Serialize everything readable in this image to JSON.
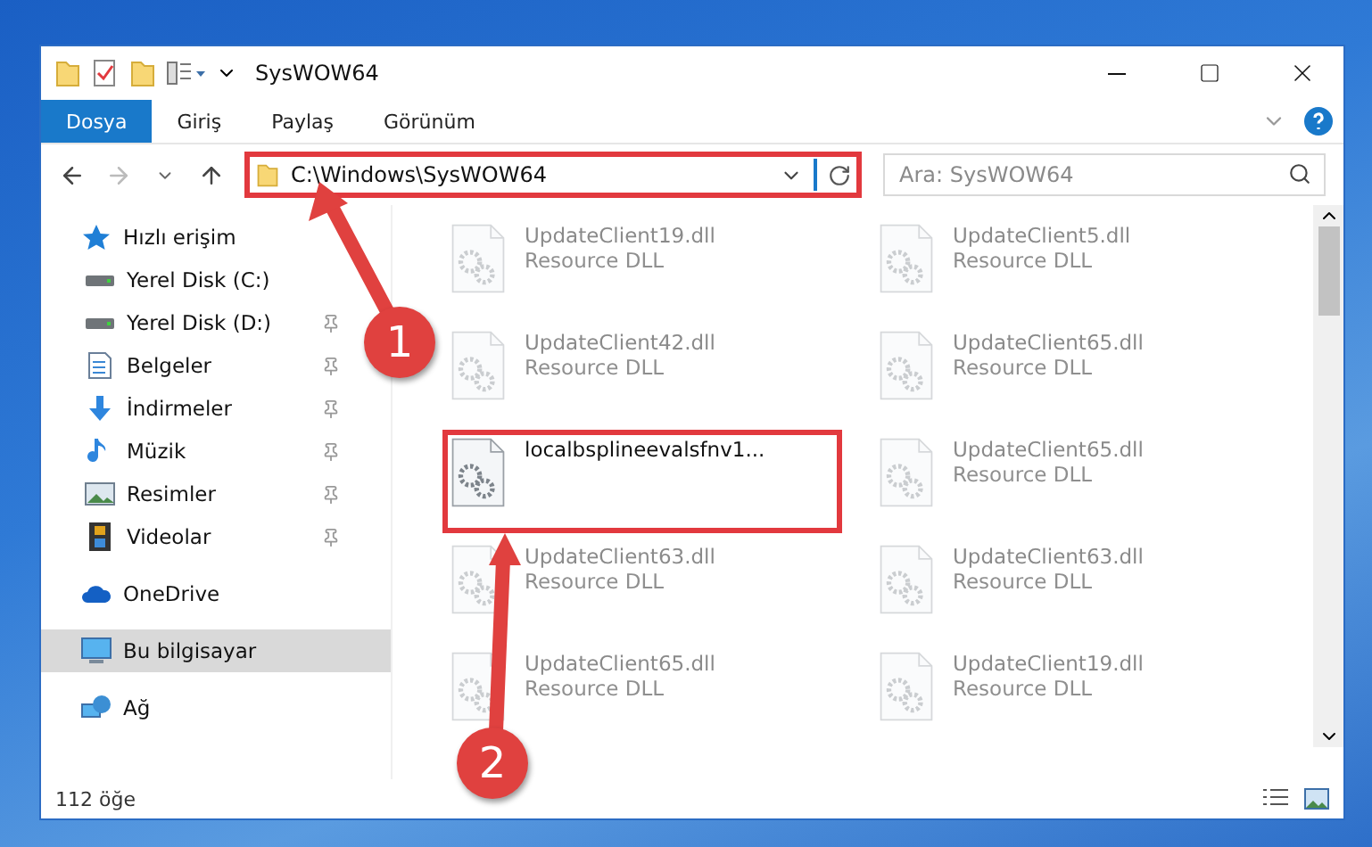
{
  "window": {
    "title": "SysWOW64"
  },
  "ribbon_tabs": [
    {
      "label": "Dosya",
      "kind": "file"
    },
    {
      "label": "Giriş",
      "kind": "tab"
    },
    {
      "label": "Paylaş",
      "kind": "tab"
    },
    {
      "label": "Görünüm",
      "kind": "tab"
    }
  ],
  "address": {
    "path": "C:\\Windows\\SysWOW64",
    "highlighted": true
  },
  "search": {
    "placeholder": "Ara: SysWOW64"
  },
  "sidebar": {
    "items": [
      {
        "label": "Hızlı erişim",
        "kind": "star",
        "selected": false,
        "children": [
          {
            "label": "Yerel Disk (C:)",
            "kind": "disk",
            "pinned": false,
            "selected": false
          },
          {
            "label": "Yerel Disk (D:)",
            "kind": "disk",
            "pinned": true,
            "selected": false
          },
          {
            "label": "Belgeler",
            "kind": "document",
            "pinned": true,
            "selected": false
          },
          {
            "label": "İndirmeler",
            "kind": "download",
            "pinned": true,
            "selected": false
          },
          {
            "label": "Müzik",
            "kind": "music",
            "pinned": true,
            "selected": false
          },
          {
            "label": "Resimler",
            "kind": "image",
            "pinned": true,
            "selected": false
          },
          {
            "label": "Videolar",
            "kind": "video",
            "pinned": true,
            "selected": false
          }
        ]
      },
      {
        "label": "OneDrive",
        "kind": "cloud",
        "selected": false
      },
      {
        "label": "Bu bilgisayar",
        "kind": "computer",
        "selected": true
      },
      {
        "label": "Ağ",
        "kind": "network",
        "selected": false
      }
    ]
  },
  "files": [
    {
      "name": "UpdateClient19.dll",
      "type": "Resource DLL",
      "dimmed": true,
      "highlighted": false
    },
    {
      "name": "UpdateClient5.dll",
      "type": "Resource DLL",
      "dimmed": true,
      "highlighted": false
    },
    {
      "name": "UpdateClient42.dll",
      "type": "Resource DLL",
      "dimmed": true,
      "highlighted": false
    },
    {
      "name": "UpdateClient65.dll",
      "type": "Resource DLL",
      "dimmed": true,
      "highlighted": false
    },
    {
      "name": "localbsplineevalsfnv1...",
      "dimmed": false,
      "highlighted": true
    },
    {
      "name": "UpdateClient65.dll",
      "type": "Resource DLL",
      "dimmed": true,
      "highlighted": false
    },
    {
      "name": "UpdateClient63.dll",
      "type": "Resource DLL",
      "dimmed": true,
      "highlighted": false
    },
    {
      "name": "UpdateClient63.dll",
      "type": "Resource DLL",
      "dimmed": true,
      "highlighted": false
    },
    {
      "name": "UpdateClient65.dll",
      "type": "Resource DLL",
      "dimmed": true,
      "highlighted": false
    },
    {
      "name": "UpdateClient19.dll",
      "type": "Resource DLL",
      "dimmed": true,
      "highlighted": false
    }
  ],
  "annotations": [
    {
      "label": "1"
    },
    {
      "label": "2"
    }
  ],
  "status_bar": {
    "count": "112 öğe"
  }
}
